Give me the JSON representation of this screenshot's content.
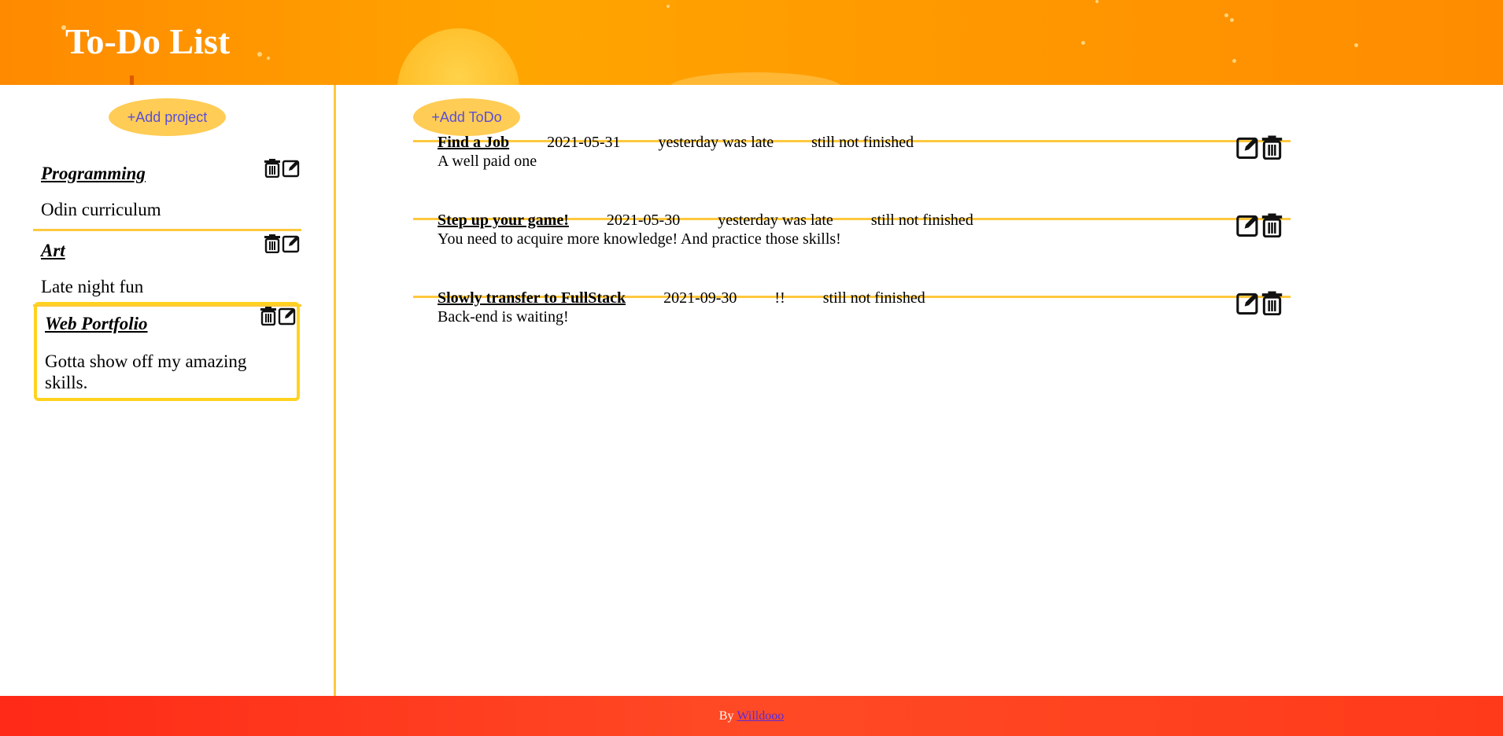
{
  "header": {
    "title": "To-Do List",
    "colors": {
      "primary": "#ff9a00",
      "sun": "#ffc02a"
    }
  },
  "sidebar": {
    "add_project_label": "+Add project",
    "projects": [
      {
        "title": "Programming",
        "description": "Odin curriculum",
        "selected": false
      },
      {
        "title": "Art",
        "description": "Late night fun",
        "selected": false
      },
      {
        "title": "Web Portfolio",
        "description": "Gotta show off my amazing skills.",
        "selected": true
      }
    ],
    "icons": {
      "delete": "trash-icon",
      "edit": "edit-icon"
    }
  },
  "main": {
    "add_todo_label": "+Add ToDo",
    "todos": [
      {
        "title": "Find a Job",
        "date": "2021-05-31",
        "status_due": "yesterday was late",
        "status_done": "still not finished",
        "description": "A well paid one"
      },
      {
        "title": "Step up your game!",
        "date": "2021-05-30",
        "status_due": "yesterday was late",
        "status_done": "still not finished",
        "description": "You need to acquire more knowledge! And practice those skills!"
      },
      {
        "title": "Slowly transfer to FullStack",
        "date": "2021-09-30",
        "status_due": "!!",
        "status_done": "still not finished",
        "description": "Back-end is waiting!"
      }
    ],
    "icons": {
      "edit": "edit-icon",
      "delete": "trash-icon"
    },
    "accent_color": "#ffc83d"
  },
  "footer": {
    "by_label": "By",
    "author_link": "Willdooo",
    "colors": {
      "background": "#ff3a1a",
      "link": "#5b2bd9"
    }
  }
}
